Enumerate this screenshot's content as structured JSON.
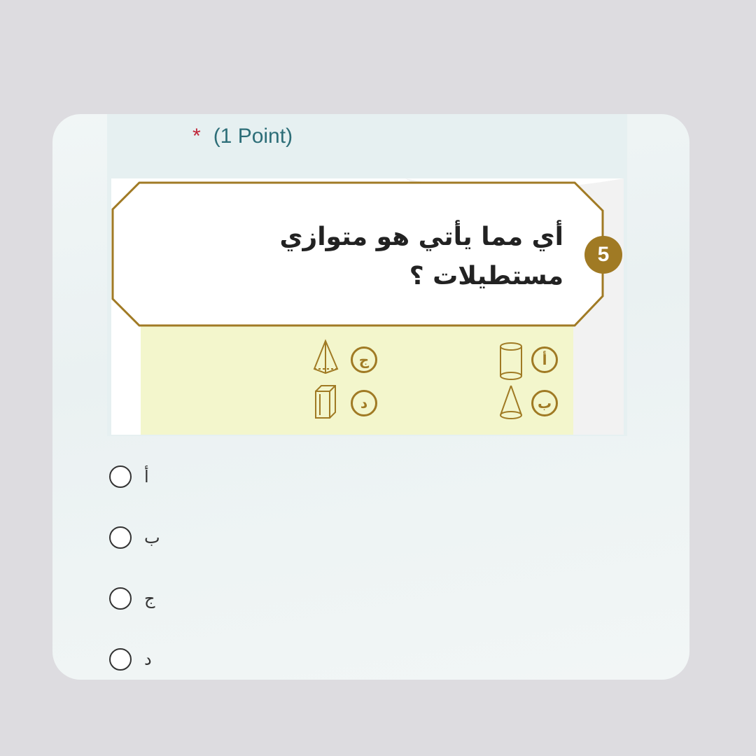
{
  "question": {
    "required_marker": "*",
    "points_label": "(1 Point)",
    "number": "5",
    "text": "أي مما يأتي هو متوازي مستطيلات ؟",
    "image_options": [
      {
        "letter": "أ",
        "shape": "cylinder-icon"
      },
      {
        "letter": "ب",
        "shape": "cone-icon"
      },
      {
        "letter": "ج",
        "shape": "pyramid-icon"
      },
      {
        "letter": "د",
        "shape": "rectangular-prism-icon"
      }
    ]
  },
  "choices": [
    {
      "label": "أ"
    },
    {
      "label": "ب"
    },
    {
      "label": "ج"
    },
    {
      "label": "د"
    }
  ],
  "colors": {
    "accent_gold": "#a07a24",
    "options_panel": "#f3f6cc",
    "points_text": "#2d6e78",
    "required_star": "#c0273a"
  }
}
